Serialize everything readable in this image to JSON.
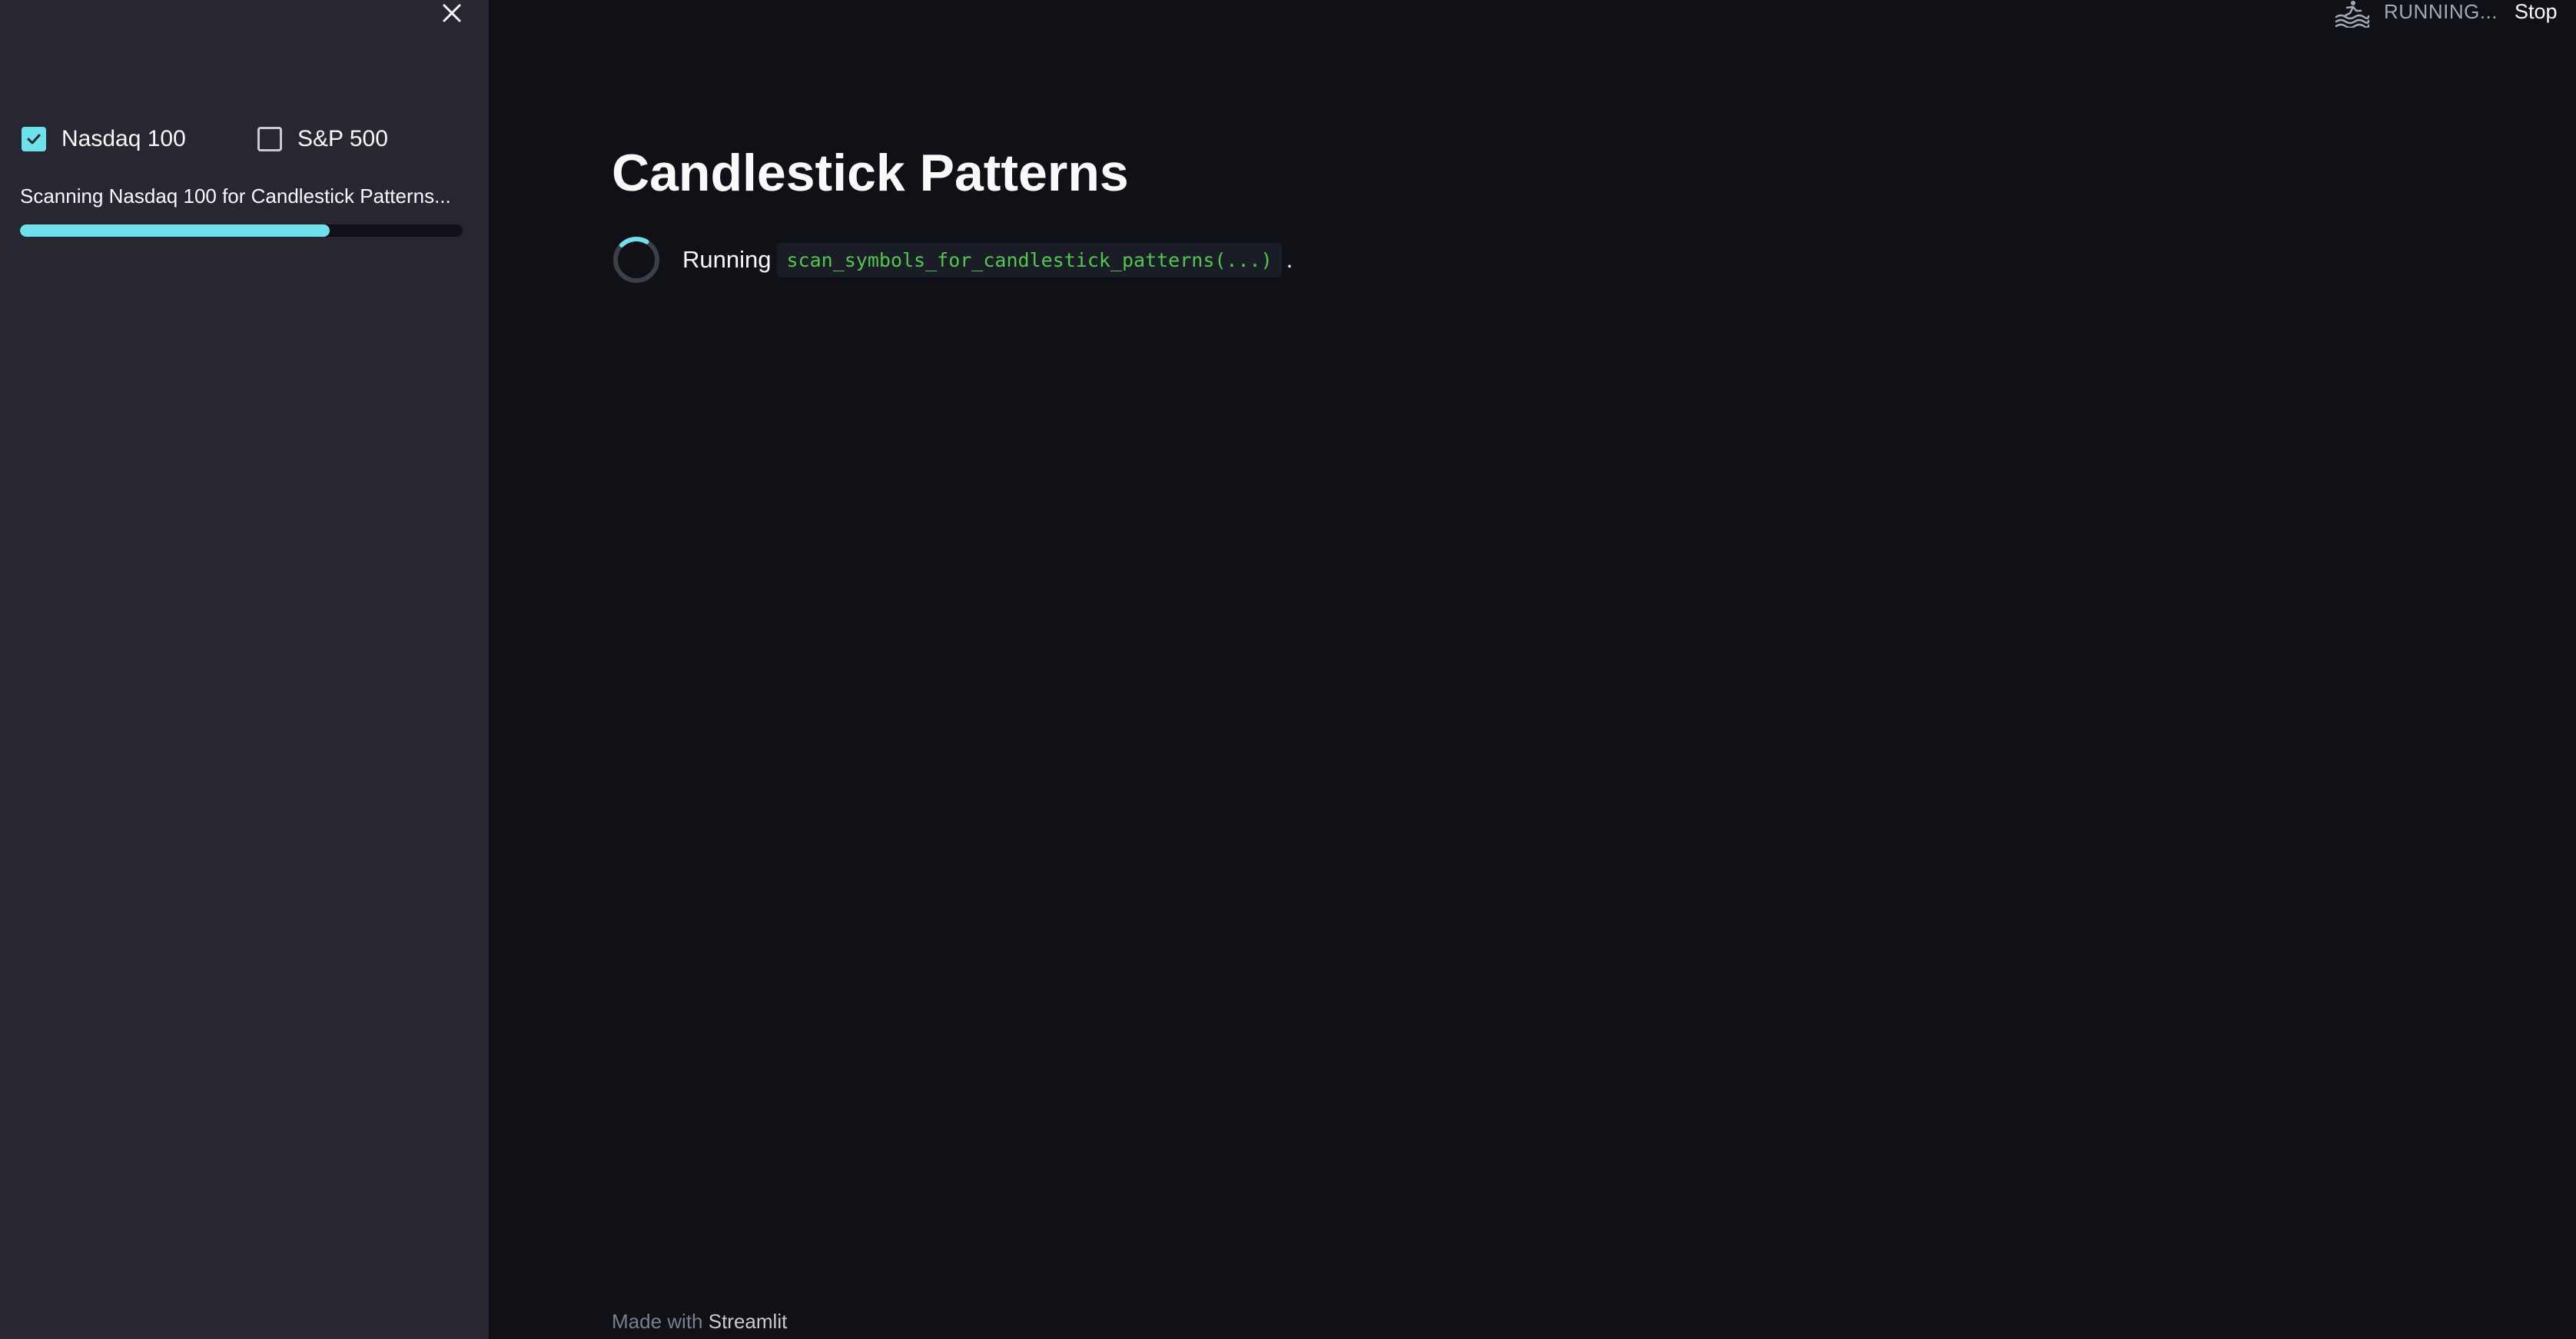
{
  "sidebar": {
    "checkboxes": [
      {
        "label": "Nasdaq 100",
        "checked": true
      },
      {
        "label": "S&P 500",
        "checked": false
      }
    ],
    "status_text": "Scanning Nasdaq 100 for Candlestick Patterns...",
    "progress": 0.7
  },
  "header": {
    "status_text": "RUNNING...",
    "stop_label": "Stop"
  },
  "main": {
    "title": "Candlestick Patterns",
    "running_label": "Running",
    "running_function": "scan_symbols_for_candlestick_patterns(...)",
    "running_suffix": "."
  },
  "footer": {
    "prefix": "Made with",
    "brand": "Streamlit"
  },
  "colors": {
    "accent": "#6ee1ec",
    "background": "#0f1117",
    "sidebar": "#262730",
    "code": "#4ec94e"
  },
  "icons": {
    "close": "close-icon",
    "running": "running-man-icon",
    "spinner": "spinner-icon",
    "check": "check-icon"
  }
}
